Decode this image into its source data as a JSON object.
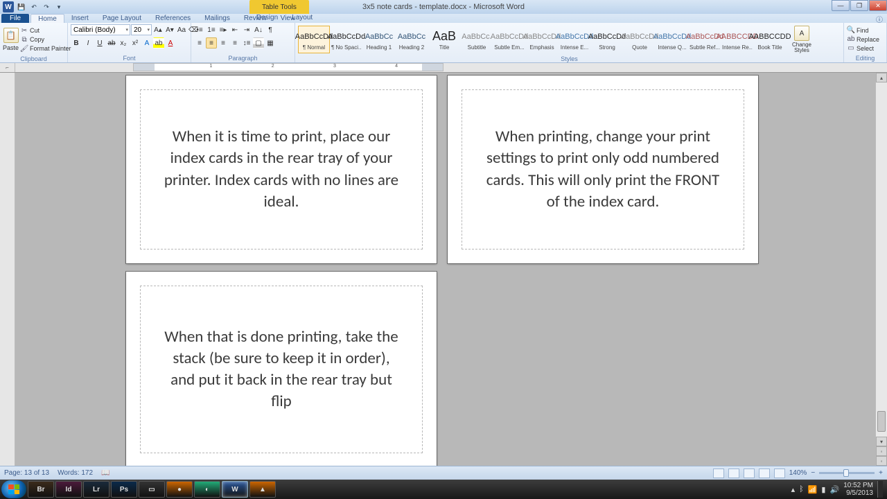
{
  "titlebar": {
    "doc_title": "3x5 note cards - template.docx - Microsoft Word",
    "context_title": "Table Tools"
  },
  "tabs": {
    "file": "File",
    "items": [
      "Home",
      "Insert",
      "Page Layout",
      "References",
      "Mailings",
      "Review",
      "View"
    ],
    "active_index": 0,
    "context": [
      "Design",
      "Layout"
    ]
  },
  "ribbon": {
    "clipboard": {
      "label": "Clipboard",
      "paste": "Paste",
      "cut": "Cut",
      "copy": "Copy",
      "format_painter": "Format Painter"
    },
    "font": {
      "label": "Font",
      "name": "Calibri (Body)",
      "size": "20"
    },
    "paragraph": {
      "label": "Paragraph"
    },
    "styles": {
      "label": "Styles",
      "change_styles": "Change Styles",
      "items": [
        {
          "preview": "AaBbCcDd",
          "name": "¶ Normal"
        },
        {
          "preview": "AaBbCcDd",
          "name": "¶ No Spaci..."
        },
        {
          "preview": "AaBbCc",
          "name": "Heading 1"
        },
        {
          "preview": "AaBbCc",
          "name": "Heading 2"
        },
        {
          "preview": "AaB",
          "name": "Title"
        },
        {
          "preview": "AaBbCc.",
          "name": "Subtitle"
        },
        {
          "preview": "AaBbCcDd",
          "name": "Subtle Em..."
        },
        {
          "preview": "AaBbCcDd",
          "name": "Emphasis"
        },
        {
          "preview": "AaBbCcDd",
          "name": "Intense E..."
        },
        {
          "preview": "AaBbCcDd",
          "name": "Strong"
        },
        {
          "preview": "AaBbCcDd",
          "name": "Quote"
        },
        {
          "preview": "AaBbCcDd",
          "name": "Intense Q..."
        },
        {
          "preview": "AaBbCcDd",
          "name": "Subtle Ref..."
        },
        {
          "preview": "AABBCCDD",
          "name": "Intense Re..."
        },
        {
          "preview": "AABBCCDD",
          "name": "Book Title"
        }
      ],
      "selected": 0
    },
    "editing": {
      "label": "Editing",
      "find": "Find",
      "replace": "Replace",
      "select": "Select"
    }
  },
  "ruler": {
    "marks": [
      "1",
      "2",
      "3",
      "4"
    ]
  },
  "cards": [
    {
      "text": "When it is time to print, place our index cards in the rear tray of your printer.  Index cards with no lines are ideal."
    },
    {
      "text": "When printing, change your print settings to print only odd numbered cards.  This will only print the FRONT of the index card."
    },
    {
      "text": "When that is done printing, take the stack (be sure to keep it in order), and put it back in the rear tray but flip"
    }
  ],
  "statusbar": {
    "page": "Page: 13 of 13",
    "words": "Words: 172",
    "zoom": "140%"
  },
  "taskbar": {
    "items": [
      {
        "label": "Br",
        "color": "#3b2b1b"
      },
      {
        "label": "Id",
        "color": "#4b1a3a"
      },
      {
        "label": "Lr",
        "color": "#1a2a3a"
      },
      {
        "label": "Ps",
        "color": "#0a2a4a"
      },
      {
        "label": "▭",
        "color": "#333"
      },
      {
        "label": "●",
        "color": "#c60"
      },
      {
        "label": "◐",
        "color": "#2a7"
      },
      {
        "label": "W",
        "color": "#2b579a",
        "active": true
      },
      {
        "label": "▲",
        "color": "#c60"
      }
    ],
    "time": "10:52 PM",
    "date": "9/5/2013"
  }
}
